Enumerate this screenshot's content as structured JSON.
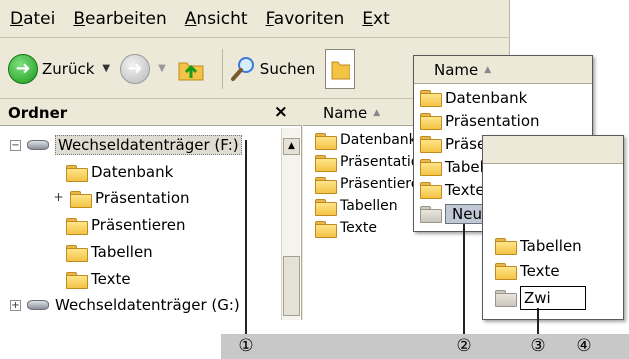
{
  "menu": [
    {
      "label": "Datei",
      "accel": "D"
    },
    {
      "label": "Bearbeiten",
      "accel": "B"
    },
    {
      "label": "Ansicht",
      "accel": "A"
    },
    {
      "label": "Favoriten",
      "accel": "F"
    },
    {
      "label": "Ext",
      "accel": "E"
    }
  ],
  "toolbar": {
    "back_label": "Zurück",
    "search_label": "Suchen"
  },
  "folder_pane": {
    "title": "Ordner",
    "close": "×",
    "tree": [
      {
        "label": "Wechseldatenträger (F:)",
        "type": "drive",
        "expander": "−",
        "selected": true
      },
      {
        "label": "Datenbank",
        "type": "folder"
      },
      {
        "label": "Präsentation",
        "type": "folder",
        "expander": "+"
      },
      {
        "label": "Präsentieren",
        "type": "folder"
      },
      {
        "label": "Tabellen",
        "type": "folder"
      },
      {
        "label": "Texte",
        "type": "folder"
      },
      {
        "label": "Wechseldatenträger (G:)",
        "type": "drive",
        "expander": "+"
      }
    ]
  },
  "list_pane": {
    "header": "Name",
    "items": [
      "Datenbank",
      "Präsentation",
      "Präsentieren",
      "Tabellen",
      "Texte"
    ]
  },
  "popup1": {
    "header": "Name",
    "items": [
      "Datenbank",
      "Präsentation",
      "Präsentieren",
      "Tabellen",
      "Texte"
    ],
    "new_folder": "Neuer Ordner"
  },
  "popup2": {
    "items": [
      "Tabellen",
      "Texte"
    ],
    "rename_value": "Zwi"
  },
  "callouts": [
    "①",
    "②",
    "③",
    "④"
  ]
}
